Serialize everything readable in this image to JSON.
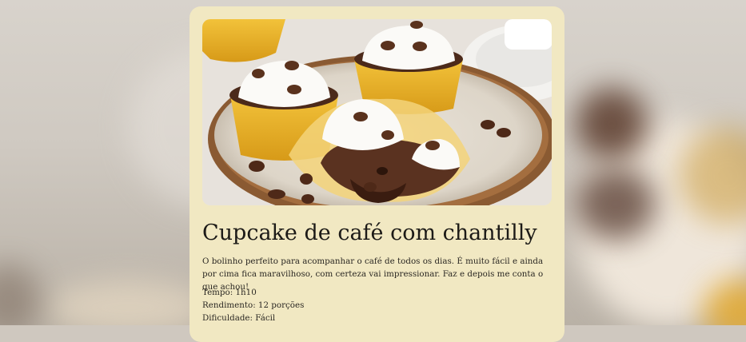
{
  "recipe": {
    "title": "Cupcake de café com chantilly",
    "description": "O bolinho perfeito para acompanhar o café de todos os dias. É muito fácil e ainda por cima fica maravilhoso, com certeza vai impressionar. Faz e depois me conta o que achou!",
    "details": {
      "time": "Tempo: 1h10",
      "servings": "Rendimento: 12 porções",
      "difficulty": "Dificuldade: Fácil"
    }
  },
  "colors": {
    "card_background": "#f1e8c2",
    "page_background": "#cfc8bf",
    "text": "#1c1a17"
  }
}
